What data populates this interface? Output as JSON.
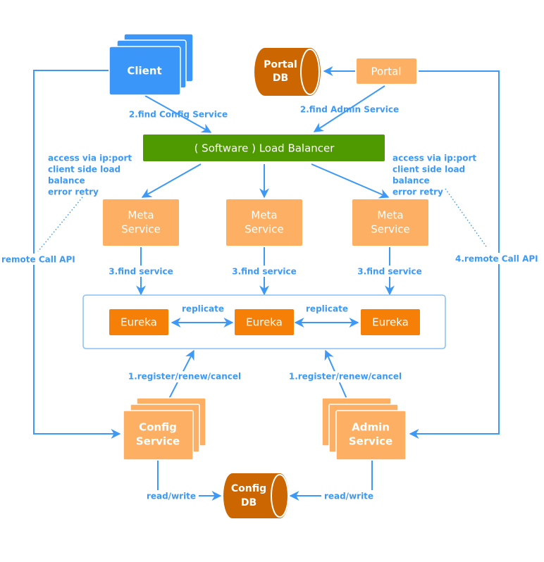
{
  "colors": {
    "line": "#3d99f5",
    "client": "#3a97f9",
    "service": "#fdb064",
    "eureka": "#f57f07",
    "db": "#cc6600",
    "lb": "#4f9a00",
    "cluster_border": "#88bff6",
    "label": "#3d99f5",
    "white": "#ffffff"
  },
  "nodes": {
    "client": "Client",
    "portal": "Portal",
    "portal_db_line1": "Portal",
    "portal_db_line2": "DB",
    "load_balancer": "( Software ) Load Balancer",
    "meta_service_line1": "Meta",
    "meta_service_line2": "Service",
    "eureka": "Eureka",
    "config_service_line1": "Config",
    "config_service_line2": "Service",
    "admin_service_line1": "Admin",
    "admin_service_line2": "Service",
    "config_db_line1": "Config",
    "config_db_line2": "DB"
  },
  "edge_labels": {
    "find_config_service": "2.find Config Service",
    "find_admin_service": "2.find Admin Service",
    "find_service": "3.find service",
    "replicate": "replicate",
    "register": "1.register/renew/cancel",
    "read_write": "read/write",
    "remote_call_left": "remote Call API",
    "remote_call_right": "4.remote Call API"
  },
  "notes": {
    "left": [
      "access via ip:port",
      "client side load",
      "balance",
      "error retry"
    ],
    "right": [
      "access via ip:port",
      "client side load",
      "balance",
      "error retry"
    ]
  }
}
